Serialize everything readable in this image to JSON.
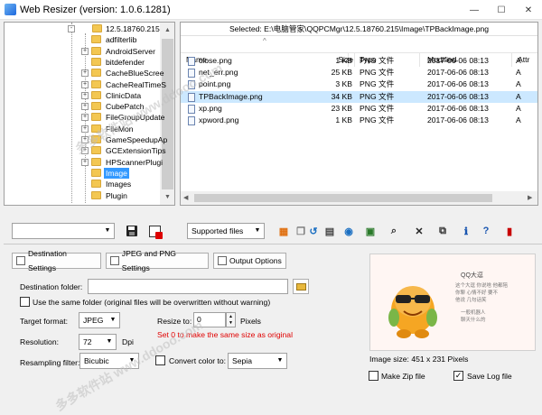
{
  "window": {
    "title": "Web Resizer (version: 1.0.6.1281)",
    "minimize": "—",
    "maximize": "☐",
    "close": "✕"
  },
  "tree": {
    "items": [
      {
        "label": "12.5.18760.215",
        "expander": "-"
      },
      {
        "label": "adfilterlib",
        "expander": ""
      },
      {
        "label": "AndroidServer",
        "expander": "+"
      },
      {
        "label": "bitdefender",
        "expander": ""
      },
      {
        "label": "CacheBlueScree",
        "expander": "+"
      },
      {
        "label": "CacheRealTimeS",
        "expander": "+"
      },
      {
        "label": "ClinicData",
        "expander": "+"
      },
      {
        "label": "CubePatch",
        "expander": "+"
      },
      {
        "label": "FileGroupUpdate",
        "expander": "+"
      },
      {
        "label": "FileMon",
        "expander": "+"
      },
      {
        "label": "GameSpeedupAp",
        "expander": "+"
      },
      {
        "label": "GCExtensionTips",
        "expander": "+"
      },
      {
        "label": "HPScannerPlugi",
        "expander": "+"
      },
      {
        "label": "Image",
        "expander": ""
      },
      {
        "label": "Images",
        "expander": ""
      },
      {
        "label": "Plugin",
        "expander": ""
      }
    ]
  },
  "files": {
    "selected_path": "Selected: E:\\电脑管家\\QQPCMgr\\12.5.18760.215\\Image\\TPBackImage.png",
    "columns": {
      "name": "Name",
      "size": "Size",
      "type": "Type",
      "modified": "Modified",
      "attr": "Attr"
    },
    "sort_arrow": "^",
    "rows": [
      {
        "name": "close.png",
        "size": "1 KB",
        "type": "PNG 文件",
        "modified": "2017-06-06 08:13",
        "attr": "A"
      },
      {
        "name": "net_err.png",
        "size": "25 KB",
        "type": "PNG 文件",
        "modified": "2017-06-06 08:13",
        "attr": "A"
      },
      {
        "name": "point.png",
        "size": "3 KB",
        "type": "PNG 文件",
        "modified": "2017-06-06 08:13",
        "attr": "A"
      },
      {
        "name": "TPBackImage.png",
        "size": "34 KB",
        "type": "PNG 文件",
        "modified": "2017-06-06 08:13",
        "attr": "A"
      },
      {
        "name": "xp.png",
        "size": "23 KB",
        "type": "PNG 文件",
        "modified": "2017-06-06 08:13",
        "attr": "A"
      },
      {
        "name": "xpword.png",
        "size": "1 KB",
        "type": "PNG 文件",
        "modified": "2017-06-06 08:13",
        "attr": "A"
      }
    ]
  },
  "toolbar": {
    "left_combo": "",
    "filter_combo": "Supported files"
  },
  "tabs": {
    "destination": "Destination Settings",
    "jpeg_png": "JPEG and PNG Settings",
    "output": "Output Options"
  },
  "settings": {
    "destination_folder_label": "Destination folder:",
    "destination_folder_value": "",
    "same_folder_label": "Use the same folder (original files will be overwritten without warning)",
    "target_format_label": "Target format:",
    "target_format_value": "JPEG",
    "resize_to_label": "Resize to:",
    "resize_to_value": "0",
    "pixels_label": "Pixels",
    "resize_hint": "Set 0 to make the same size as original",
    "resolution_label": "Resolution:",
    "resolution_value": "72",
    "dpi_label": "Dpi",
    "resampling_label": "Resampling filter:",
    "resampling_value": "Bicubic",
    "convert_color_label": "Convert color to:",
    "convert_color_value": "Sepia"
  },
  "preview": {
    "image_size": "Image size: 451 x 231 Pixels",
    "make_zip_label": "Make Zip file",
    "save_log_label": "Save Log file",
    "save_log_checked": "✓",
    "qq_title": "QQ大逗",
    "qq_line1": "这个大逗 你说啥 他都陪",
    "qq_line2": "你聊 心情不好 要不",
    "qq_line3": "他说 几句话笑",
    "qq_line4": "一般机器人",
    "qq_line5": "聊天什么的"
  },
  "colors": {
    "selection": "#cce8ff",
    "tree_selection": "#3399ff",
    "hint_red": "#e00000"
  },
  "icons": {
    "save": "floppy-icon",
    "delete_list": "delete-list-icon",
    "browse": "folder-browse-icon"
  },
  "watermark": {
    "text": "多多软件站 www.ddooo.com"
  }
}
